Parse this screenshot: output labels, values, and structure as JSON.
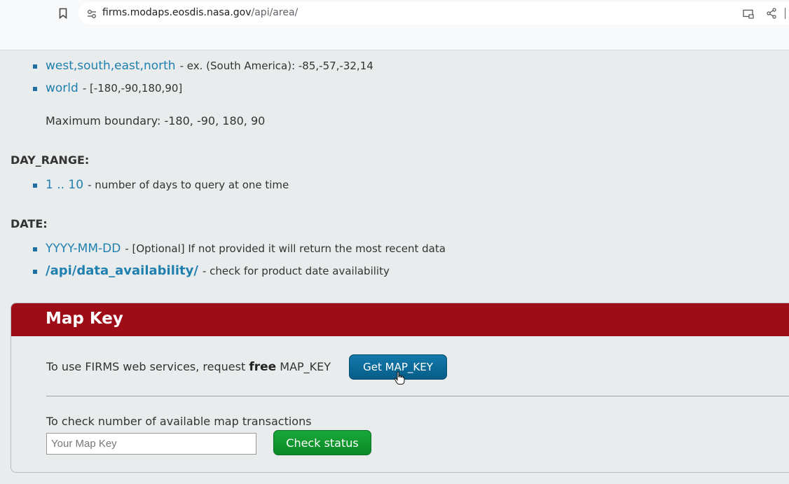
{
  "browser": {
    "url_host": "firms.modaps.eosdis.nasa.gov",
    "url_path": "/api/area/"
  },
  "area_items": [
    {
      "link": "west,south,east,north",
      "desc": "- ex. (South America): -85,-57,-32,14"
    },
    {
      "link": "world",
      "desc": "- [-180,-90,180,90]"
    }
  ],
  "max_boundary": "Maximum boundary: -180, -90, 180, 90",
  "day_range": {
    "heading": "DAY_RANGE:",
    "items": [
      {
        "link": "1 .. 10",
        "desc": "- number of days to query at one time"
      }
    ]
  },
  "date": {
    "heading": "DATE:",
    "items": [
      {
        "link": "YYYY-MM-DD",
        "desc": "- [Optional] If not provided it will return the most recent data"
      },
      {
        "link": "/api/data_availability/",
        "desc": "- check for product date availability"
      }
    ]
  },
  "map_key": {
    "title": "Map Key",
    "request_prefix": "To use FIRMS web services, request",
    "request_bold": "free",
    "request_suffix": "MAP_KEY",
    "get_button": "Get MAP_KEY",
    "check_label": "To check number of available map transactions",
    "input_placeholder": "Your Map Key",
    "check_button": "Check status"
  },
  "colors": {
    "panel_header": "#9e0c17",
    "link": "#1f7fae",
    "get_button": "#0b6a99",
    "check_button": "#14a034"
  }
}
